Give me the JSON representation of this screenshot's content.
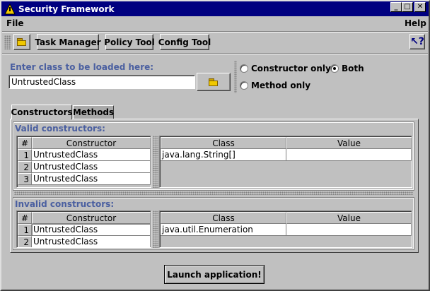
{
  "window": {
    "title": "Security Framework"
  },
  "menubar": {
    "file": "File",
    "help": "Help"
  },
  "toolbar": {
    "task_manager": "Task Manager",
    "policy_tool": "Policy Tool",
    "config_tool": "Config Tool"
  },
  "class_input": {
    "label": "Enter class to be loaded here:",
    "value": "UntrustedClass"
  },
  "mode": {
    "constructor_only": "Constructor only",
    "method_only": "Method only",
    "both": "Both",
    "selected": "Both"
  },
  "tabs": {
    "constructors": "Constructors",
    "methods": "Methods",
    "active": "Constructors"
  },
  "valid": {
    "label": "Valid constructors:",
    "left_headers": [
      "#",
      "Constructor"
    ],
    "rows": [
      {
        "num": "1",
        "name": "UntrustedClass"
      },
      {
        "num": "2",
        "name": "UntrustedClass"
      },
      {
        "num": "3",
        "name": "UntrustedClass"
      }
    ],
    "right_headers": [
      "Class",
      "Value"
    ],
    "params": [
      {
        "class": "java.lang.String[]",
        "value": ""
      }
    ]
  },
  "invalid": {
    "label": "Invalid constructors:",
    "left_headers": [
      "#",
      "Constructor"
    ],
    "rows": [
      {
        "num": "1",
        "name": "UntrustedClass"
      },
      {
        "num": "2",
        "name": "UntrustedClass"
      }
    ],
    "right_headers": [
      "Class",
      "Value"
    ],
    "params": [
      {
        "class": "java.util.Enumeration",
        "value": ""
      }
    ]
  },
  "launch_button": "Launch application!",
  "colors": {
    "titlebar": "#000080",
    "accent_label": "#4a5fa0",
    "face": "#c0c0c0"
  }
}
